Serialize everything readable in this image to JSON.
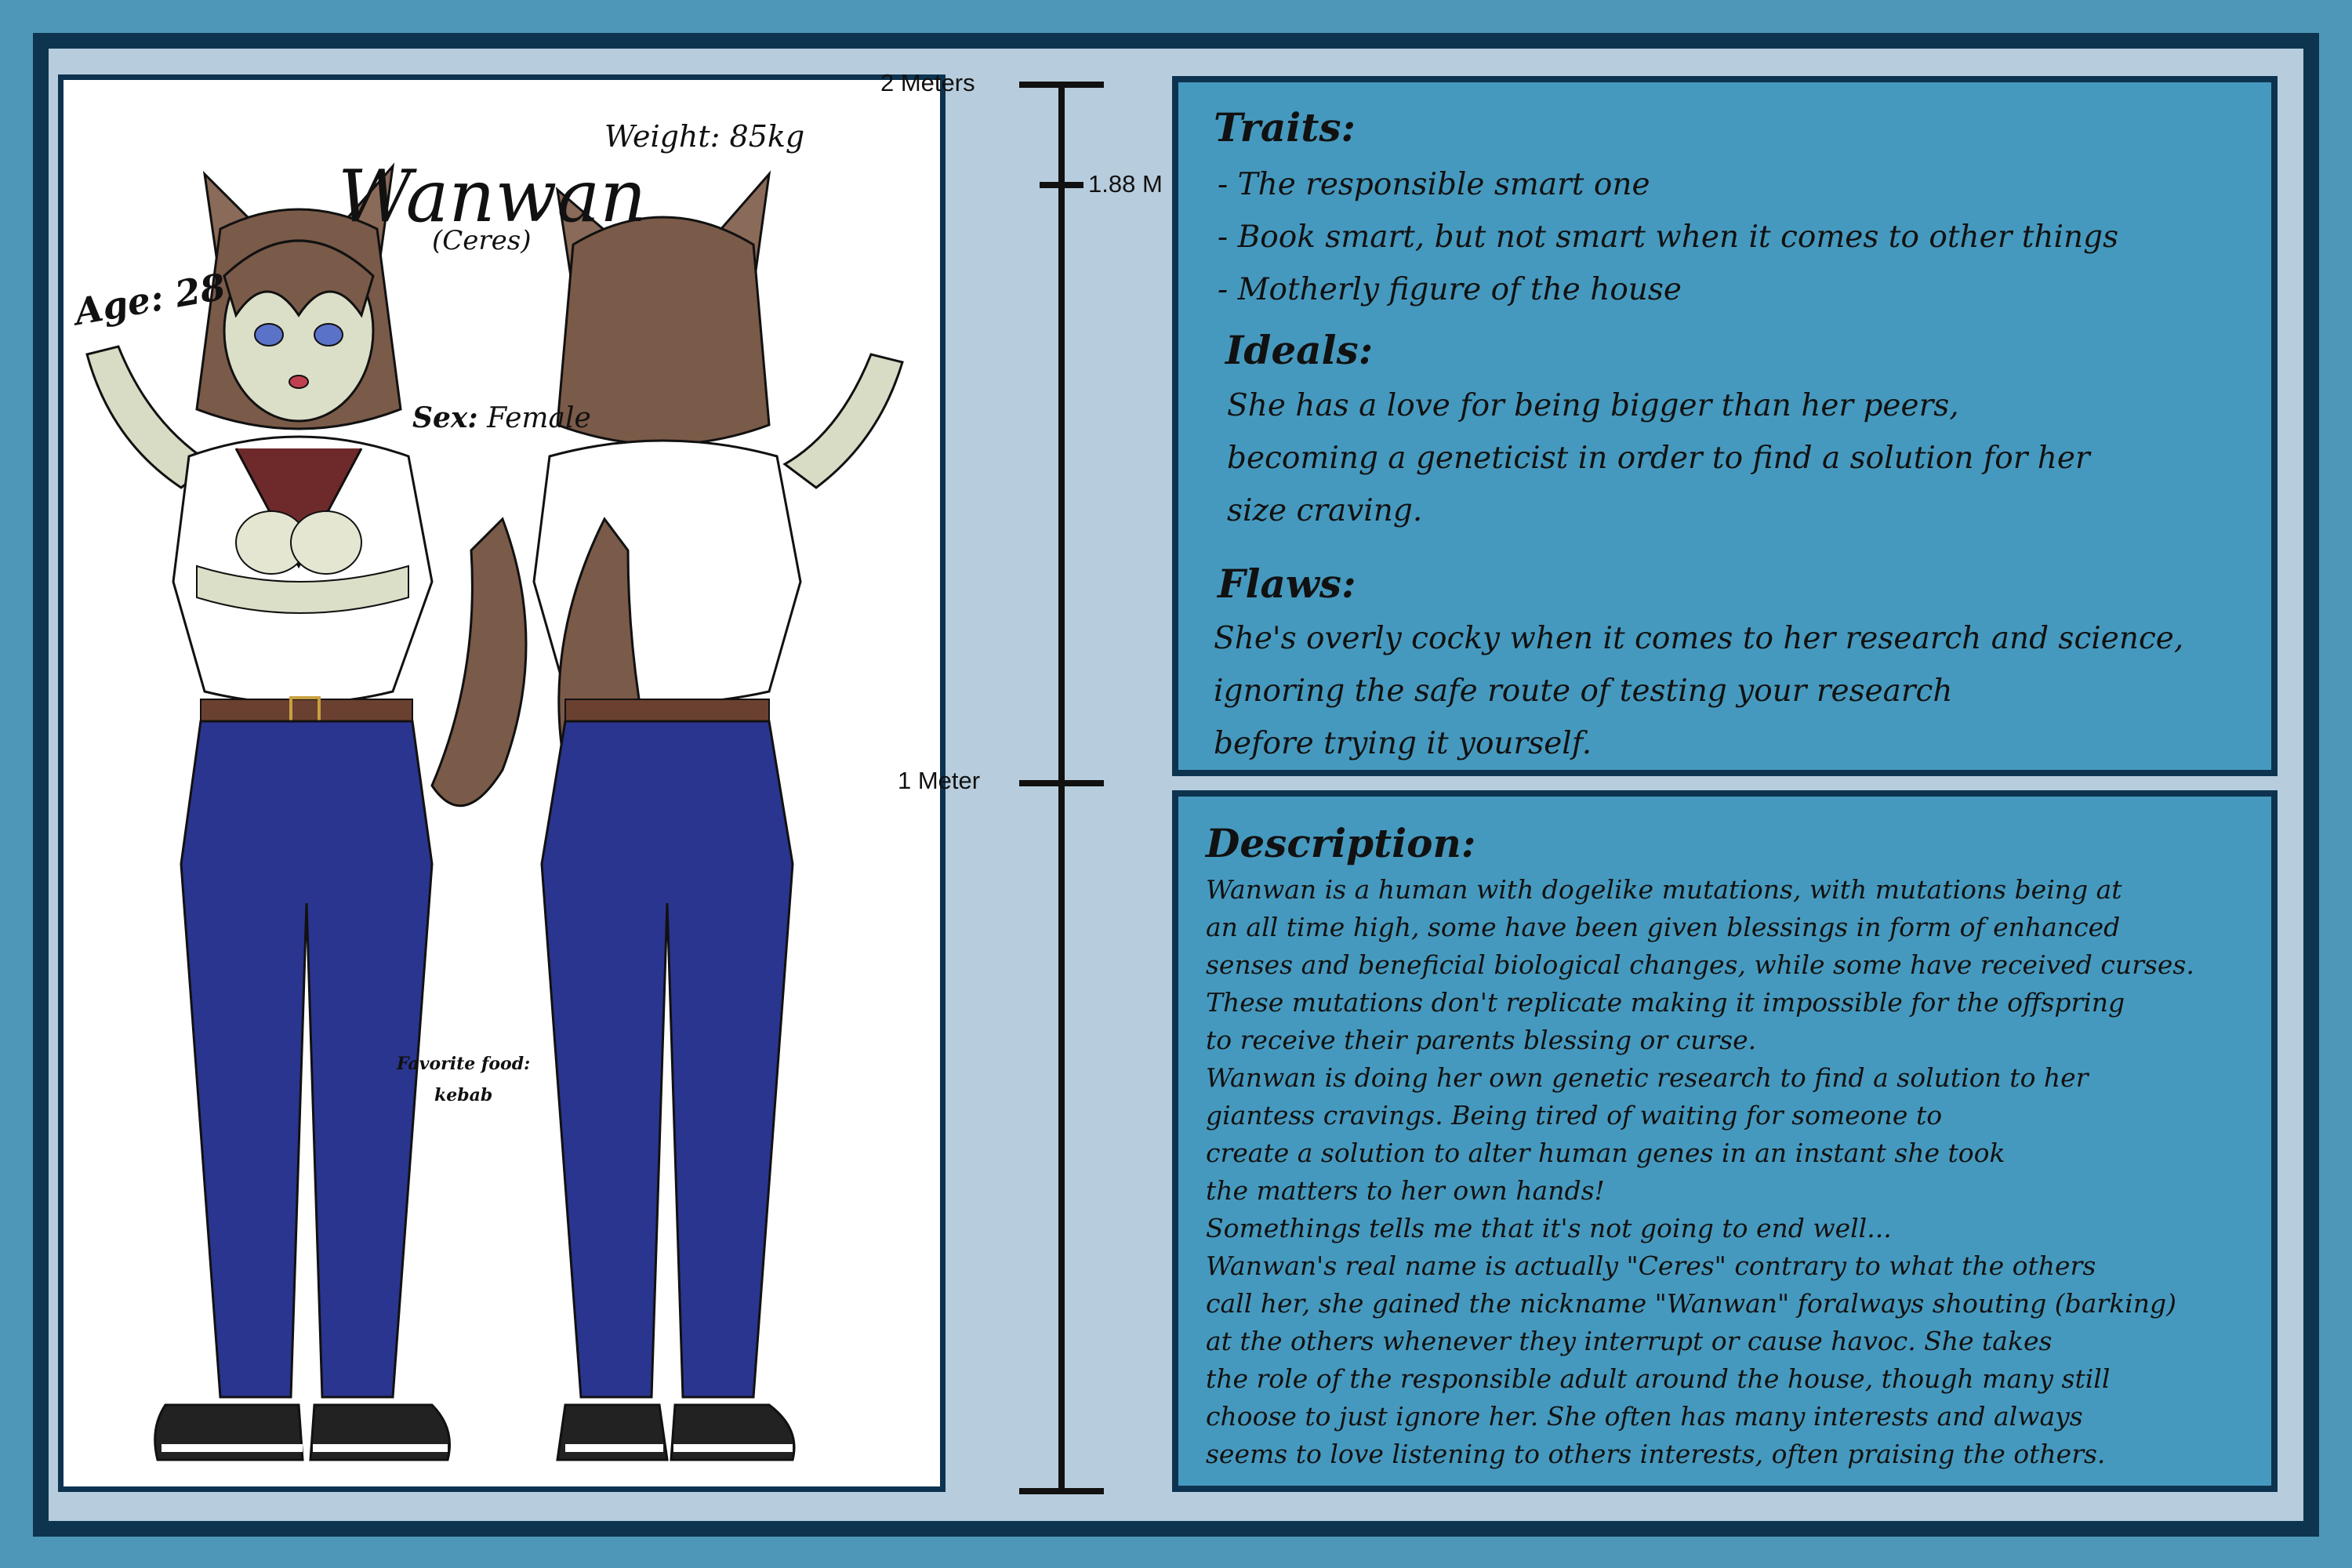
{
  "character": {
    "name": "Wanwan",
    "alias": "(Ceres)",
    "weight": "Weight: 85kg",
    "age": "Age: 28",
    "sex_label": "Sex:",
    "sex_value": "Female",
    "favorite_food_label": "Favorite food:",
    "favorite_food_value": "kebab"
  },
  "scale": {
    "top": "2 Meters",
    "mid": "1.88 M",
    "low": "1 Meter"
  },
  "traits": {
    "title": "Traits:",
    "items": [
      "- The responsible smart one",
      "- Book smart, but not smart when it comes to other things",
      "- Motherly figure of the house"
    ]
  },
  "ideals": {
    "title": "Ideals:",
    "lines": [
      "She has a love for being bigger than her peers,",
      "becoming a geneticist in order to find a solution for her",
      "size craving."
    ]
  },
  "flaws": {
    "title": "Flaws:",
    "lines": [
      "She's overly cocky when it comes to her research and science,",
      "ignoring the safe route of testing your research",
      "before trying it yourself."
    ]
  },
  "description": {
    "title": "Description:",
    "lines": [
      "Wanwan is a human with dogelike mutations, with mutations being at",
      "an all time high, some have been given blessings in form of enhanced",
      "senses and beneficial biological changes, while some have received curses.",
      "These mutations don't replicate making it impossible for the offspring",
      "to receive their parents blessing or curse.",
      "Wanwan is doing her own genetic research to find a solution to her",
      "giantess cravings. Being tired of waiting for someone to",
      "create a solution to alter human genes in an instant she took",
      "the matters to her own hands!",
      "Somethings tells me that it's not going to end well...",
      "Wanwan's real name is actually \"Ceres\" contrary to what the others",
      "call her, she gained the nickname \"Wanwan\" foralways shouting (barking)",
      "at the others whenever they interrupt or cause havoc. She takes",
      "the role of the responsible adult around the house, though many still",
      "choose to just ignore her. She often has many interests and always",
      "seems to love listening to others interests, often praising the others."
    ]
  },
  "colors": {
    "frame": "#0e3550",
    "background": "#b7cddd",
    "panel": "#4699be",
    "jeans": "#2a3590",
    "hair": "#7a5a48",
    "skin": "#d9dcc4"
  }
}
